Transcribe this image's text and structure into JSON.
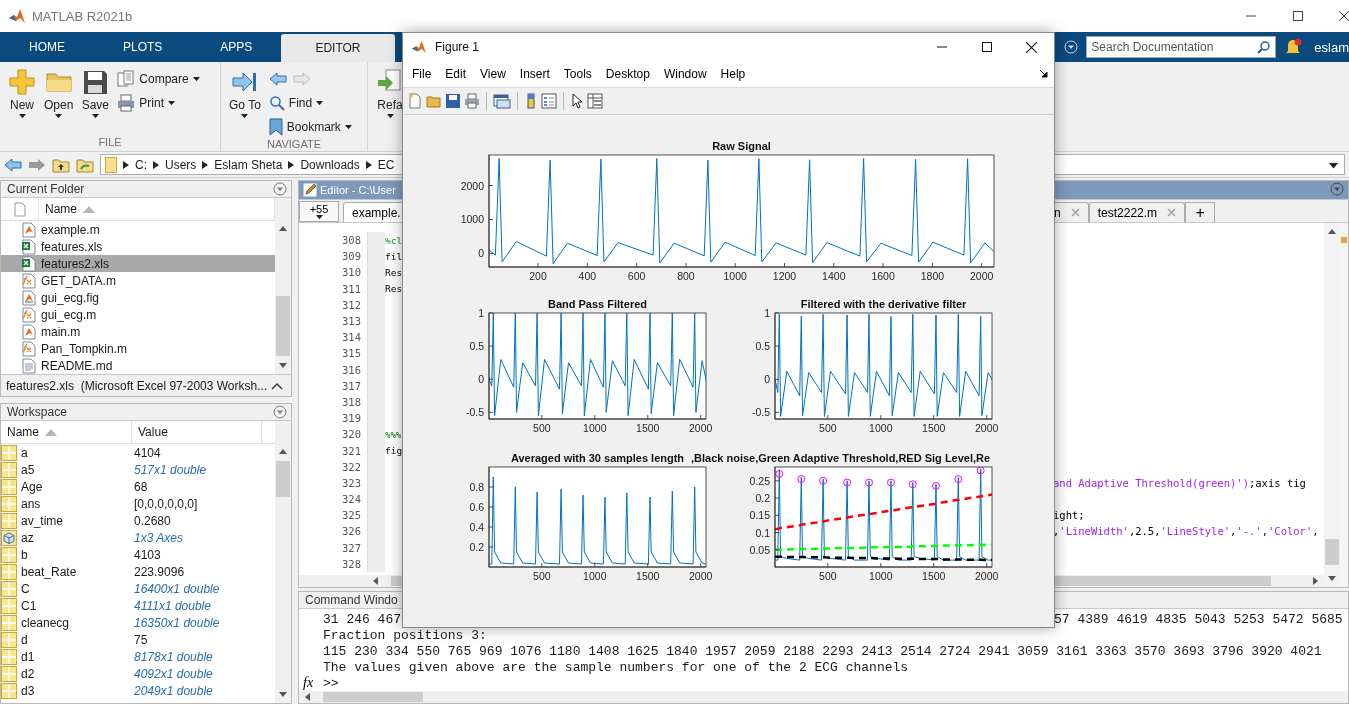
{
  "window": {
    "title": "MATLAB R2021b"
  },
  "toolstrip": {
    "tabs": [
      {
        "label": "HOME",
        "selected": false
      },
      {
        "label": "PLOTS",
        "selected": false
      },
      {
        "label": "APPS",
        "selected": false
      },
      {
        "label": "EDITOR",
        "selected": true
      }
    ],
    "search": {
      "placeholder": "Search Documentation"
    },
    "user": "eslam"
  },
  "ribbon": {
    "groups": [
      {
        "label": "FILE",
        "buttons": [
          {
            "label": "New",
            "kind": "large"
          },
          {
            "label": "Open",
            "kind": "large"
          },
          {
            "label": "Save",
            "kind": "large"
          },
          {
            "label": "Compare",
            "kind": "small"
          },
          {
            "label": "Print",
            "kind": "small"
          }
        ]
      },
      {
        "label": "NAVIGATE",
        "buttons": [
          {
            "label": "Go To",
            "kind": "large"
          },
          {
            "kind": "arrows"
          },
          {
            "label": "Find",
            "kind": "small"
          },
          {
            "label": "Bookmark",
            "kind": "small"
          }
        ]
      },
      {
        "buttons": [
          {
            "label": "Refa",
            "kind": "large"
          }
        ]
      }
    ]
  },
  "address_bar": {
    "path": [
      "C:",
      "Users",
      "Eslam Sheta",
      "Downloads",
      "EC"
    ]
  },
  "current_folder": {
    "title": "Current Folder",
    "column": "Name",
    "files": [
      {
        "name": "example.m",
        "kind": "script",
        "selected": false
      },
      {
        "name": "features.xls",
        "kind": "spreadsheet",
        "selected": false
      },
      {
        "name": "features2.xls",
        "kind": "spreadsheet",
        "selected": true
      },
      {
        "name": "GET_DATA.m",
        "kind": "function",
        "selected": false
      },
      {
        "name": "gui_ecg.fig",
        "kind": "figure",
        "selected": false
      },
      {
        "name": "gui_ecg.m",
        "kind": "function",
        "selected": false
      },
      {
        "name": "main.m",
        "kind": "script",
        "selected": false
      },
      {
        "name": "Pan_Tompkin.m",
        "kind": "function",
        "selected": false
      },
      {
        "name": "README.md",
        "kind": "text",
        "selected": false
      }
    ],
    "details": "features2.xls  (Microsoft Excel 97-2003 Worksh..."
  },
  "workspace": {
    "title": "Workspace",
    "columns": [
      "Name",
      "Value"
    ],
    "variables": [
      {
        "name": "a",
        "value": "4104",
        "kind": "scalar"
      },
      {
        "name": "a5",
        "value": "517x1 double",
        "kind": "array"
      },
      {
        "name": "Age",
        "value": "68",
        "kind": "scalar"
      },
      {
        "name": "ans",
        "value": "[0,0,0,0,0,0]",
        "kind": "scalar"
      },
      {
        "name": "av_time",
        "value": "0.2680",
        "kind": "scalar"
      },
      {
        "name": "az",
        "value": "1x3 Axes",
        "kind": "object"
      },
      {
        "name": "b",
        "value": "4103",
        "kind": "scalar"
      },
      {
        "name": "beat_Rate",
        "value": "223.9096",
        "kind": "scalar"
      },
      {
        "name": "C",
        "value": "16400x1 double",
        "kind": "array"
      },
      {
        "name": "C1",
        "value": "4111x1 double",
        "kind": "array"
      },
      {
        "name": "cleanecg",
        "value": "16350x1 double",
        "kind": "array"
      },
      {
        "name": "d",
        "value": "75",
        "kind": "scalar"
      },
      {
        "name": "d1",
        "value": "8178x1 double",
        "kind": "array"
      },
      {
        "name": "d2",
        "value": "4092x1 double",
        "kind": "array"
      },
      {
        "name": "d3",
        "value": "2049x1 double",
        "kind": "array"
      }
    ]
  },
  "editor": {
    "title": "Editor - C:\\User",
    "hidden_tabs": "+55",
    "tabs": [
      {
        "label": "example.",
        "selected": true
      },
      {
        "label": "n",
        "selected": false
      },
      {
        "label": "test2222.m",
        "selected": false
      }
    ],
    "new_tab": "+",
    "lines": [
      {
        "number": "308",
        "code": [
          {
            "text": "%cl",
            "kind": "comment"
          }
        ]
      },
      {
        "number": "309",
        "code": [
          {
            "text": "fil",
            "kind": "plain"
          }
        ]
      },
      {
        "number": "310",
        "code": [
          {
            "text": "Res",
            "kind": "plain"
          }
        ]
      },
      {
        "number": "311",
        "code": [
          {
            "text": "Res",
            "kind": "plain"
          }
        ]
      },
      {
        "number": "312"
      },
      {
        "number": "313"
      },
      {
        "number": "314"
      },
      {
        "number": "315"
      },
      {
        "number": "316"
      },
      {
        "number": "317"
      },
      {
        "number": "318"
      },
      {
        "number": "319"
      },
      {
        "number": "320",
        "code": [
          {
            "text": "%%%",
            "kind": "cell"
          }
        ]
      },
      {
        "number": "321",
        "code": [
          {
            "text": "fig",
            "kind": "plain"
          }
        ]
      },
      {
        "number": "322"
      },
      {
        "number": "323",
        "tail": [
          {
            "text": "and Adaptive Threshold(green)')",
            "kind": "string"
          },
          {
            "text": ";axis tig",
            "kind": "plain"
          }
        ]
      },
      {
        "number": "324"
      },
      {
        "number": "325",
        "tail": [
          {
            "text": "ight;",
            "kind": "plain"
          }
        ]
      },
      {
        "number": "326",
        "tail": [
          {
            "text": ",",
            "kind": "plain"
          },
          {
            "text": "'LineWidth'",
            "kind": "string"
          },
          {
            "text": ",2.5,",
            "kind": "plain"
          },
          {
            "text": "'LineStyle'",
            "kind": "string"
          },
          {
            "text": ",",
            "kind": "plain"
          },
          {
            "text": "'-.'",
            "kind": "string"
          },
          {
            "text": ",",
            "kind": "plain"
          },
          {
            "text": "'Color'",
            "kind": "string"
          },
          {
            "text": ",",
            "kind": "plain"
          }
        ]
      },
      {
        "number": "327"
      },
      {
        "number": "328"
      }
    ]
  },
  "command_window": {
    "title": "Command Windo",
    "lines": [
      {
        "text": "31 246 467",
        "tail": "57 4389 4619 4835 5043 5253 5472 5685"
      },
      {
        "text": "Fraction positions 3:"
      },
      {
        "text": "115 230 334 550 765 969 1076 1180 1408 1625 1840 1957 2059 2188 2293 2413 2514 2724 2941 3059 3161 3363 3570 3693 3796 3920 4021"
      },
      {
        "text": "The values given above are the sample numbers for one of the 2 ECG channels"
      }
    ],
    "function_browser": "fx",
    "prompt": ">>"
  },
  "figure": {
    "title": "Figure 1",
    "menu": [
      "File",
      "Edit",
      "View",
      "Insert",
      "Tools",
      "Desktop",
      "Window",
      "Help"
    ],
    "charts": [
      {
        "chart_data": {
          "type": "line",
          "title": "Raw Signal",
          "x": [
            1,
            27,
            42,
            54,
            112,
            234,
            249,
            261,
            319,
            440,
            455,
            467,
            525,
            667,
            682,
            694,
            752,
            874,
            889,
            901,
            959,
            1081,
            1096,
            1108,
            1166,
            1287,
            1302,
            1314,
            1372,
            1506,
            1521,
            1533,
            1591,
            1717,
            1732,
            1744,
            1802,
            1928,
            1943,
            1955,
            2013,
            2050
          ],
          "xlim": [
            1,
            2050
          ],
          "ylim": [
            -400,
            2900
          ],
          "xticks": [
            200,
            400,
            600,
            800,
            1000,
            1200,
            1400,
            1600,
            1800,
            2000
          ],
          "yticks": [
            0,
            1000,
            2000
          ],
          "series": [
            {
              "color": "#0072bd",
              "values": [
                100,
                -50,
                2800,
                -250,
                350,
                -80,
                2750,
                -300,
                300,
                -60,
                2780,
                -250,
                320,
                -50,
                2800,
                -280,
                300,
                -70,
                2750,
                -260,
                330,
                -60,
                2790,
                -250,
                310,
                -50,
                2760,
                -270,
                320,
                -80,
                2800,
                -250,
                300,
                -60,
                2770,
                -260,
                330,
                -50,
                2790,
                -280,
                310,
                50
              ]
            }
          ]
        }
      },
      {
        "chart_data": {
          "type": "line",
          "title": "Band Pass Filtered",
          "x": [
            1,
            27,
            42,
            54,
            112,
            234,
            249,
            261,
            319,
            440,
            455,
            467,
            525,
            667,
            682,
            694,
            752,
            874,
            889,
            901,
            959,
            1081,
            1096,
            1108,
            1166,
            1287,
            1302,
            1314,
            1372,
            1506,
            1521,
            1533,
            1591,
            1717,
            1732,
            1744,
            1802,
            1928,
            1943,
            1955,
            2013,
            2050
          ],
          "xlim": [
            1,
            2050
          ],
          "ylim": [
            -0.6,
            1
          ],
          "xticks": [
            500,
            1000,
            1500,
            2000
          ],
          "yticks": [
            -0.5,
            0,
            0.5,
            1
          ],
          "series": [
            {
              "color": "#0072bd",
              "values": [
                0,
                -0.1,
                1,
                -0.55,
                0.3,
                -0.12,
                1,
                -0.5,
                0.25,
                -0.1,
                1,
                -0.55,
                0.3,
                -0.15,
                1,
                -0.52,
                0.25,
                -0.1,
                1,
                -0.55,
                0.3,
                -0.12,
                1,
                -0.5,
                0.28,
                -0.1,
                1,
                -0.55,
                0.3,
                -0.15,
                1,
                -0.52,
                0.25,
                -0.1,
                1,
                -0.55,
                0.3,
                -0.12,
                1,
                -0.5,
                0.28,
                0
              ]
            }
          ]
        }
      },
      {
        "chart_data": {
          "type": "line",
          "title": "Filtered with the derivative filter",
          "x": [
            1,
            27,
            42,
            54,
            112,
            234,
            249,
            261,
            319,
            440,
            455,
            467,
            525,
            667,
            682,
            694,
            752,
            874,
            889,
            901,
            959,
            1081,
            1096,
            1108,
            1166,
            1287,
            1302,
            1314,
            1372,
            1506,
            1521,
            1533,
            1591,
            1717,
            1732,
            1744,
            1802,
            1928,
            1943,
            1955,
            2013,
            2050
          ],
          "xlim": [
            1,
            2050
          ],
          "ylim": [
            -0.6,
            1
          ],
          "xticks": [
            500,
            1000,
            1500,
            2000
          ],
          "yticks": [
            -0.5,
            0,
            0.5,
            1
          ],
          "series": [
            {
              "color": "#0072bd",
              "values": [
                0,
                -0.2,
                0.98,
                -0.56,
                0.12,
                -0.25,
                0.95,
                -0.55,
                0.1,
                -0.2,
                0.98,
                -0.56,
                0.12,
                -0.22,
                0.97,
                -0.56,
                0.1,
                -0.2,
                0.98,
                -0.56,
                0.12,
                -0.25,
                0.95,
                -0.55,
                0.1,
                -0.2,
                0.98,
                -0.56,
                0.12,
                -0.22,
                0.97,
                -0.56,
                0.1,
                -0.2,
                0.98,
                -0.56,
                0.12,
                -0.25,
                0.95,
                -0.55,
                0.1,
                0
              ]
            }
          ]
        }
      },
      {
        "chart_data": {
          "type": "line",
          "title": "Averaged with 30 samples length",
          "x": [
            1,
            27,
            42,
            54,
            112,
            234,
            249,
            261,
            319,
            440,
            455,
            467,
            525,
            667,
            682,
            694,
            752,
            874,
            889,
            901,
            959,
            1081,
            1096,
            1108,
            1166,
            1287,
            1302,
            1314,
            1372,
            1506,
            1521,
            1533,
            1591,
            1717,
            1732,
            1744,
            1802,
            1928,
            1943,
            1955,
            2013,
            2050
          ],
          "xlim": [
            1,
            2050
          ],
          "ylim": [
            0,
            1
          ],
          "xticks": [
            500,
            1000,
            1500,
            2000
          ],
          "yticks": [
            0.2,
            0.4,
            0.6,
            0.8
          ],
          "series": [
            {
              "color": "#0072bd",
              "values": [
                0.03,
                0.03,
                0.9,
                0.15,
                0.04,
                0.03,
                0.8,
                0.15,
                0.04,
                0.03,
                0.75,
                0.15,
                0.04,
                0.03,
                0.78,
                0.15,
                0.04,
                0.03,
                0.72,
                0.15,
                0.04,
                0.03,
                0.7,
                0.15,
                0.04,
                0.03,
                0.74,
                0.15,
                0.04,
                0.03,
                0.7,
                0.15,
                0.04,
                0.03,
                0.76,
                0.15,
                0.04,
                0.03,
                0.8,
                0.15,
                0.04,
                0.03
              ]
            }
          ]
        }
      },
      {
        "chart_data": {
          "type": "line",
          "title": ",Black noise,Green Adaptive Threshold,RED Sig Level,Re",
          "x": [
            1,
            27,
            42,
            54,
            112,
            234,
            249,
            261,
            319,
            440,
            455,
            467,
            525,
            667,
            682,
            694,
            752,
            874,
            889,
            901,
            959,
            1081,
            1096,
            1108,
            1166,
            1287,
            1302,
            1314,
            1372,
            1506,
            1521,
            1533,
            1591,
            1717,
            1732,
            1744,
            1802,
            1928,
            1943,
            1955,
            2013,
            2050
          ],
          "xlim": [
            1,
            2050
          ],
          "ylim": [
            0,
            0.29
          ],
          "xticks": [
            500,
            1000,
            1500,
            2000
          ],
          "yticks": [
            0.05,
            0.1,
            0.15,
            0.2,
            0.25
          ],
          "series": [
            {
              "color": "#0072bd",
              "values": [
                0.02,
                0.02,
                0.28,
                0.03,
                0.025,
                0.02,
                0.26,
                0.03,
                0.025,
                0.02,
                0.255,
                0.03,
                0.025,
                0.02,
                0.25,
                0.03,
                0.02,
                0.02,
                0.25,
                0.03,
                0.025,
                0.02,
                0.25,
                0.03,
                0.02,
                0.02,
                0.245,
                0.03,
                0.025,
                0.02,
                0.24,
                0.03,
                0.02,
                0.02,
                0.26,
                0.03,
                0.02,
                0.02,
                0.285,
                0.03,
                0.02,
                0.02
              ]
            },
            {
              "type": "scatter",
              "color": "#ff00ff",
              "marker": "o",
              "values": [
                null,
                null,
                0.27,
                null,
                null,
                null,
                0.255,
                null,
                null,
                null,
                0.25,
                null,
                null,
                null,
                0.245,
                null,
                null,
                null,
                0.245,
                null,
                null,
                null,
                0.245,
                null,
                null,
                null,
                0.24,
                null,
                null,
                null,
                0.235,
                null,
                null,
                null,
                0.255,
                null,
                null,
                null,
                0.28,
                null,
                null,
                null
              ]
            },
            {
              "color": "#ff0000",
              "line_style": "dashed",
              "values": [
                0.11,
                0.111,
                0.112,
                0.113,
                0.115,
                0.121,
                0.122,
                0.123,
                0.126,
                0.131,
                0.132,
                0.133,
                0.136,
                0.143,
                0.143,
                0.144,
                0.147,
                0.153,
                0.153,
                0.154,
                0.157,
                0.163,
                0.163,
                0.164,
                0.167,
                0.173,
                0.174,
                0.174,
                0.177,
                0.183,
                0.184,
                0.185,
                0.188,
                0.194,
                0.194,
                0.195,
                0.198,
                0.204,
                0.205,
                0.205,
                0.208,
                0.21
              ]
            },
            {
              "color": "#00ff00",
              "line_style": "dashed",
              "values": [
                0.05,
                0.05,
                0.05,
                0.05,
                0.051,
                0.052,
                0.052,
                0.052,
                0.052,
                0.053,
                0.053,
                0.053,
                0.054,
                0.055,
                0.055,
                0.055,
                0.055,
                0.056,
                0.056,
                0.057,
                0.057,
                0.058,
                0.058,
                0.058,
                0.058,
                0.059,
                0.06,
                0.06,
                0.06,
                0.061,
                0.061,
                0.061,
                0.062,
                0.063,
                0.063,
                0.063,
                0.063,
                0.064,
                0.064,
                0.064,
                0.065,
                0.065
              ]
            },
            {
              "color": "#000000",
              "line_style": "dashed",
              "values": [
                0.03,
                0.03,
                0.03,
                0.03,
                0.029,
                0.029,
                0.029,
                0.029,
                0.028,
                0.028,
                0.028,
                0.028,
                0.027,
                0.027,
                0.027,
                0.027,
                0.026,
                0.026,
                0.026,
                0.026,
                0.025,
                0.025,
                0.025,
                0.025,
                0.024,
                0.024,
                0.024,
                0.024,
                0.023,
                0.023,
                0.023,
                0.023,
                0.022,
                0.022,
                0.022,
                0.022,
                0.021,
                0.021,
                0.021,
                0.021,
                0.02,
                0.02
              ]
            }
          ]
        }
      }
    ]
  }
}
